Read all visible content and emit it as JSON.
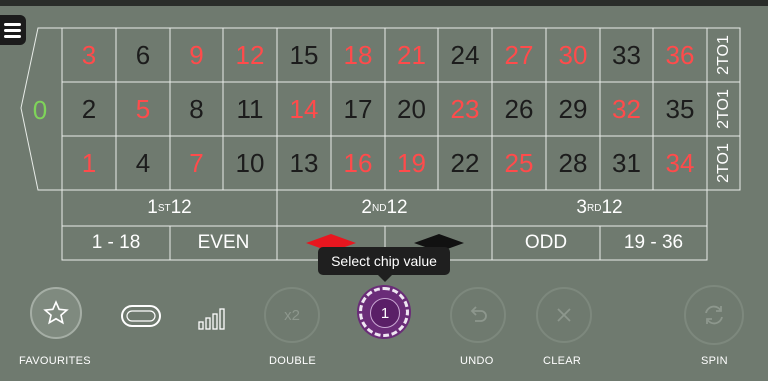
{
  "numbers": {
    "row_top": [
      {
        "n": "3",
        "c": "red"
      },
      {
        "n": "6",
        "c": "black"
      },
      {
        "n": "9",
        "c": "red"
      },
      {
        "n": "12",
        "c": "red"
      },
      {
        "n": "15",
        "c": "black"
      },
      {
        "n": "18",
        "c": "red"
      },
      {
        "n": "21",
        "c": "red"
      },
      {
        "n": "24",
        "c": "black"
      },
      {
        "n": "27",
        "c": "red"
      },
      {
        "n": "30",
        "c": "red"
      },
      {
        "n": "33",
        "c": "black"
      },
      {
        "n": "36",
        "c": "red"
      }
    ],
    "row_middle": [
      {
        "n": "2",
        "c": "black"
      },
      {
        "n": "5",
        "c": "red"
      },
      {
        "n": "8",
        "c": "black"
      },
      {
        "n": "11",
        "c": "black"
      },
      {
        "n": "14",
        "c": "red"
      },
      {
        "n": "17",
        "c": "black"
      },
      {
        "n": "20",
        "c": "black"
      },
      {
        "n": "23",
        "c": "red"
      },
      {
        "n": "26",
        "c": "black"
      },
      {
        "n": "29",
        "c": "black"
      },
      {
        "n": "32",
        "c": "red"
      },
      {
        "n": "35",
        "c": "black"
      }
    ],
    "row_bottom": [
      {
        "n": "1",
        "c": "red"
      },
      {
        "n": "4",
        "c": "black"
      },
      {
        "n": "7",
        "c": "red"
      },
      {
        "n": "10",
        "c": "black"
      },
      {
        "n": "13",
        "c": "black"
      },
      {
        "n": "16",
        "c": "red"
      },
      {
        "n": "19",
        "c": "red"
      },
      {
        "n": "22",
        "c": "black"
      },
      {
        "n": "25",
        "c": "red"
      },
      {
        "n": "28",
        "c": "black"
      },
      {
        "n": "31",
        "c": "black"
      },
      {
        "n": "34",
        "c": "red"
      }
    ]
  },
  "zero": "0",
  "column_bet": "2TO1",
  "dozens": [
    {
      "num": "1",
      "sup": "ST",
      "label": "12"
    },
    {
      "num": "2",
      "sup": "ND",
      "label": "12"
    },
    {
      "num": "3",
      "sup": "RD",
      "label": "12"
    }
  ],
  "outside": {
    "low": "1 - 18",
    "even": "EVEN",
    "odd": "ODD",
    "high": "19 - 36"
  },
  "tooltip": "Select chip value",
  "chip": {
    "value": "1",
    "color": "#6a2c78"
  },
  "controls": {
    "favourites": "FAVOURITES",
    "double": "DOUBLE",
    "double_icon_text": "x2",
    "undo": "UNDO",
    "clear": "CLEAR",
    "spin": "SPIN"
  },
  "colors": {
    "felt": "#6f7a6f",
    "red_number": "#ff4b4b",
    "black_number": "#1c1c1c",
    "zero": "#7fd45a",
    "red_diamond": "#e8161f",
    "black_diamond": "#111111"
  }
}
